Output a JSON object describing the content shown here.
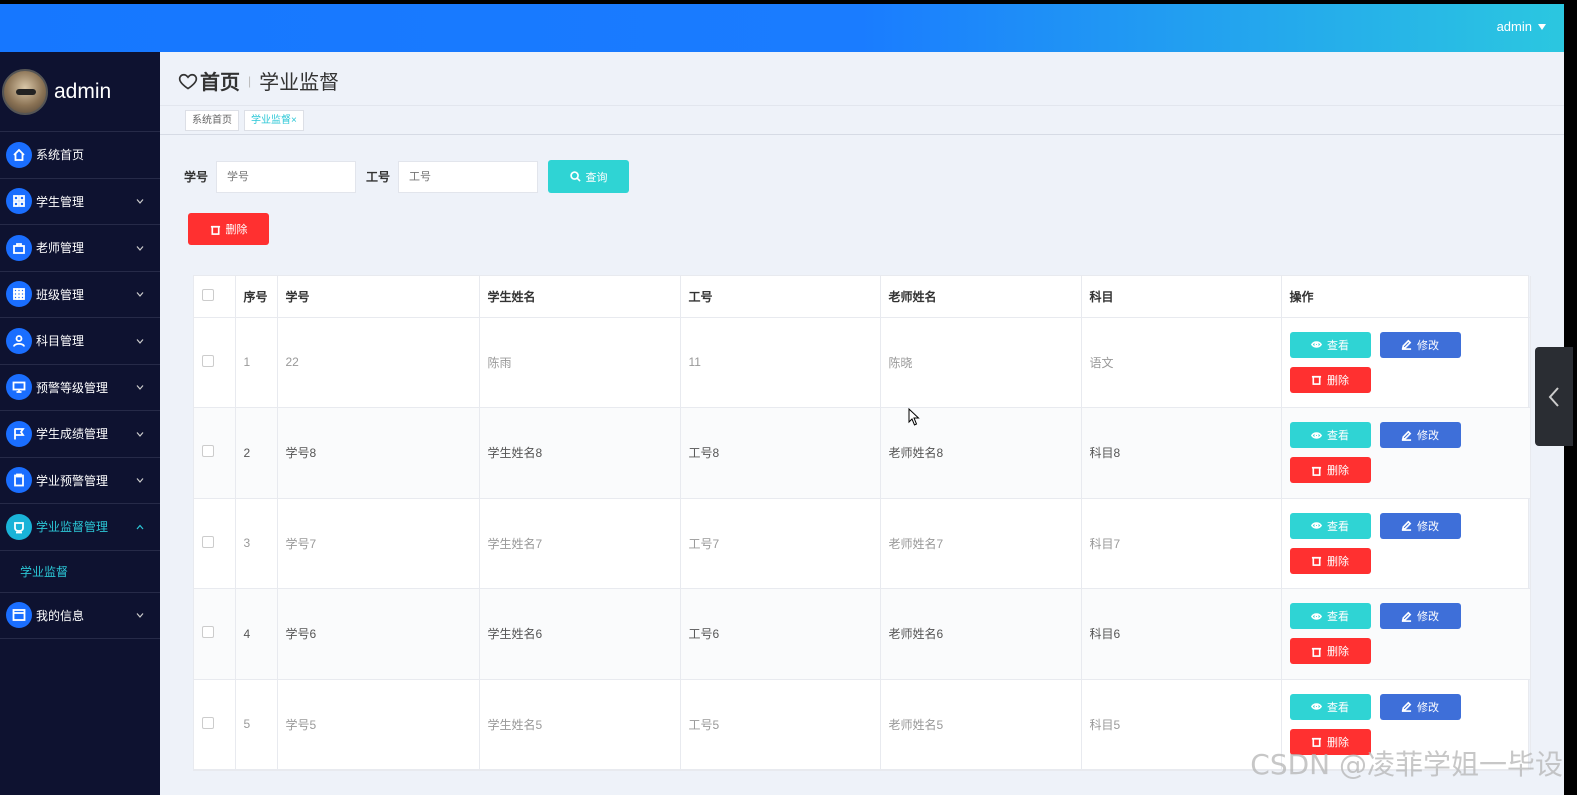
{
  "topbar": {
    "user": "admin"
  },
  "sidebar": {
    "username": "admin",
    "items": [
      {
        "label": "系统首页",
        "icon": "home-icon",
        "expandable": false
      },
      {
        "label": "学生管理",
        "icon": "grid-icon",
        "expandable": true
      },
      {
        "label": "老师管理",
        "icon": "briefcase-icon",
        "expandable": true
      },
      {
        "label": "班级管理",
        "icon": "apps-icon",
        "expandable": true
      },
      {
        "label": "科目管理",
        "icon": "user-icon",
        "expandable": true
      },
      {
        "label": "预警等级管理",
        "icon": "monitor-icon",
        "expandable": true
      },
      {
        "label": "学生成绩管理",
        "icon": "flag-icon",
        "expandable": true
      },
      {
        "label": "学业预警管理",
        "icon": "clipboard-icon",
        "expandable": true
      },
      {
        "label": "学业监督管理",
        "icon": "cup-icon",
        "expandable": true,
        "active": true
      },
      {
        "label": "我的信息",
        "icon": "window-icon",
        "expandable": true
      }
    ],
    "submenu": {
      "label": "学业监督"
    }
  },
  "page": {
    "home": "首页",
    "separator": "|",
    "title": "学业监督",
    "tabs": [
      "系统首页",
      "学业监督×"
    ]
  },
  "search": {
    "field1_label": "学号",
    "field1_placeholder": "学号",
    "field2_label": "工号",
    "field2_placeholder": "工号",
    "query_label": "查询"
  },
  "actions": {
    "delete_label": "删除"
  },
  "table": {
    "headers": [
      "",
      "序号",
      "学号",
      "学生姓名",
      "工号",
      "老师姓名",
      "科目",
      "操作"
    ],
    "rows": [
      [
        "1",
        "22",
        "陈雨",
        "11",
        "陈晓",
        "语文"
      ],
      [
        "2",
        "学号8",
        "学生姓名8",
        "工号8",
        "老师姓名8",
        "科目8"
      ],
      [
        "3",
        "学号7",
        "学生姓名7",
        "工号7",
        "老师姓名7",
        "科目7"
      ],
      [
        "4",
        "学号6",
        "学生姓名6",
        "工号6",
        "老师姓名6",
        "科目6"
      ],
      [
        "5",
        "学号5",
        "学生姓名5",
        "工号5",
        "老师姓名5",
        "科目5"
      ]
    ],
    "row_actions": {
      "view": "查看",
      "edit": "修改",
      "delete": "删除"
    }
  },
  "watermark": "CSDN @凌菲学姐一毕设"
}
